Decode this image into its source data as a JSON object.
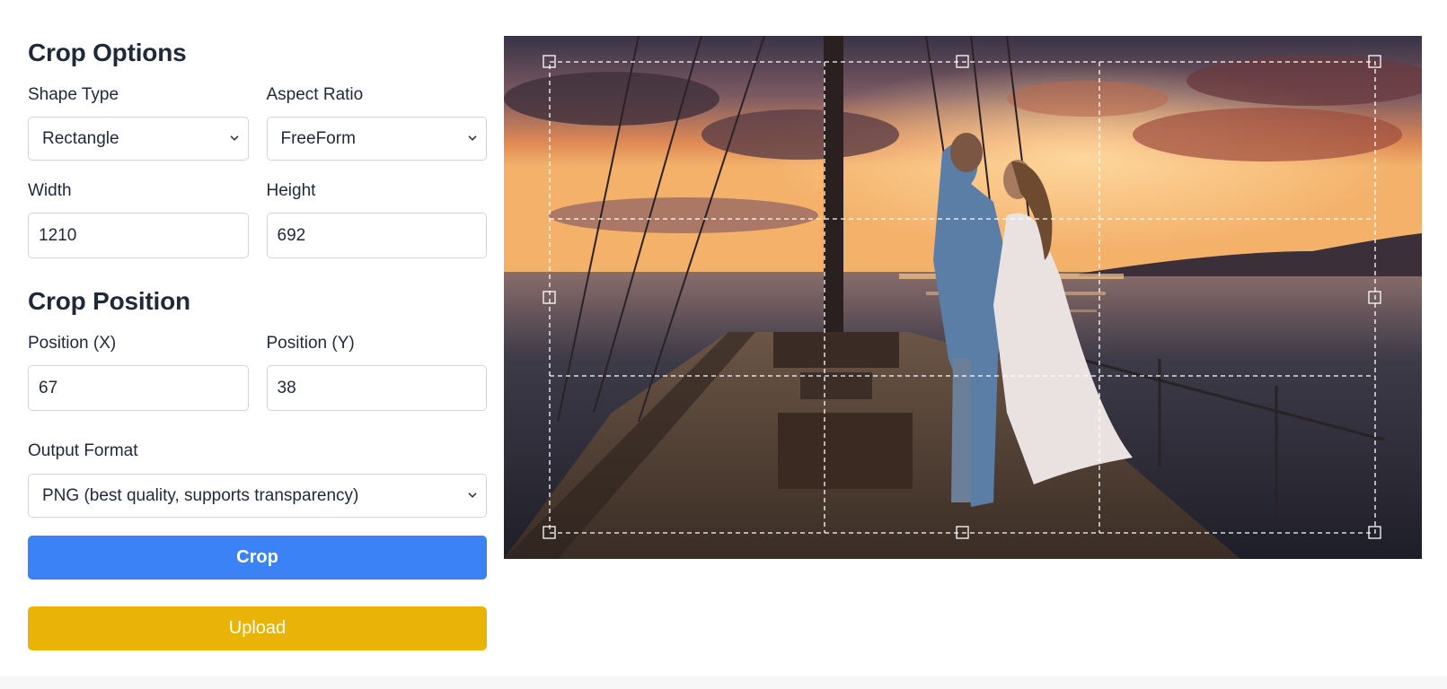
{
  "crop_options": {
    "title": "Crop Options",
    "shape_type": {
      "label": "Shape Type",
      "value": "Rectangle"
    },
    "aspect_ratio": {
      "label": "Aspect Ratio",
      "value": "FreeForm"
    },
    "width": {
      "label": "Width",
      "value": "1210"
    },
    "height": {
      "label": "Height",
      "value": "692"
    }
  },
  "crop_position": {
    "title": "Crop Position",
    "x": {
      "label": "Position (X)",
      "value": "67"
    },
    "y": {
      "label": "Position (Y)",
      "value": "38"
    }
  },
  "output": {
    "label": "Output Format",
    "value": "PNG (best quality, supports transparency)"
  },
  "buttons": {
    "crop": "Crop",
    "upload": "Upload"
  },
  "colors": {
    "primary": "#3b82f6",
    "upload": "#eab308"
  },
  "icons": {
    "select_chevron": "chevron-down-icon",
    "crop_handle": "square-handle"
  }
}
